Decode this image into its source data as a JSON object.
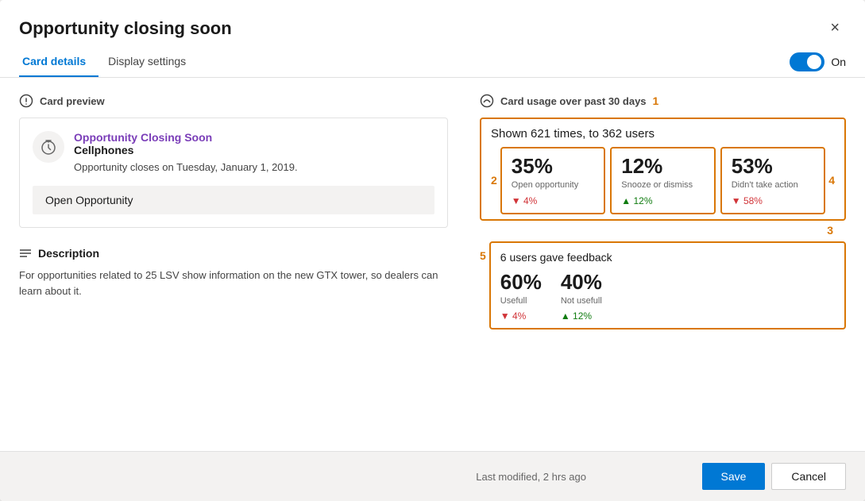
{
  "modal": {
    "title": "Opportunity closing soon",
    "close_btn": "×"
  },
  "tabs": {
    "items": [
      {
        "label": "Card details",
        "active": true
      },
      {
        "label": "Display settings",
        "active": false
      }
    ],
    "toggle_label": "On"
  },
  "left": {
    "card_preview_label": "Card preview",
    "card": {
      "title": "Opportunity Closing Soon",
      "company": "Cellphones",
      "date": "Opportunity closes on Tuesday, January 1, 2019.",
      "action_btn": "Open Opportunity"
    },
    "description_label": "Description",
    "description_text": "For opportunities related to 25 LSV show information on the new GTX tower, so dealers can learn about it."
  },
  "right": {
    "usage_label": "Card usage over past 30 days",
    "shown_text": "Shown 621 times, to 362 users",
    "stats": [
      {
        "pct": "35%",
        "label": "Open opportunity",
        "change": "▼ 4%",
        "change_dir": "down"
      },
      {
        "pct": "12%",
        "label": "Snooze or dismiss",
        "change": "▲ 12%",
        "change_dir": "up"
      },
      {
        "pct": "53%",
        "label": "Didn't take action",
        "change": "▼ 58%",
        "change_dir": "down"
      }
    ],
    "feedback": {
      "title": "6 users gave feedback",
      "items": [
        {
          "pct": "60%",
          "label": "Usefull",
          "change": "▼ 4%",
          "change_dir": "down"
        },
        {
          "pct": "40%",
          "label": "Not usefull",
          "change": "▲ 12%",
          "change_dir": "up"
        }
      ]
    },
    "annotations": [
      "1",
      "2",
      "3",
      "4",
      "5"
    ]
  },
  "footer": {
    "modified": "Last modified, 2 hrs ago",
    "save_label": "Save",
    "cancel_label": "Cancel"
  }
}
